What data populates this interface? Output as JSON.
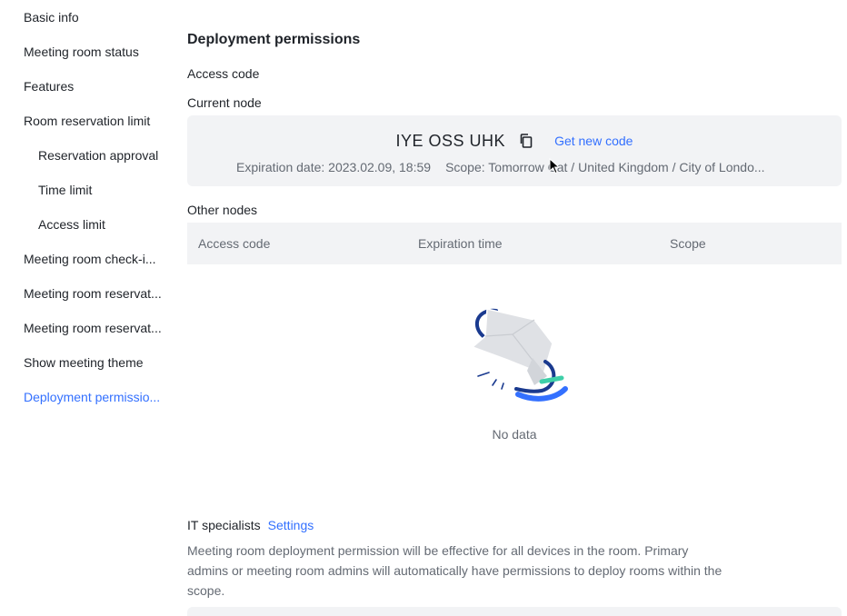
{
  "sidebar": {
    "items": [
      {
        "label": "Basic info"
      },
      {
        "label": "Meeting room status"
      },
      {
        "label": "Features"
      },
      {
        "label": "Room reservation limit"
      },
      {
        "label": "Reservation approval"
      },
      {
        "label": "Time limit"
      },
      {
        "label": "Access limit"
      },
      {
        "label": "Meeting room check-i..."
      },
      {
        "label": "Meeting room reservat..."
      },
      {
        "label": "Meeting room reservat..."
      },
      {
        "label": "Show meeting theme"
      },
      {
        "label": "Deployment permissio..."
      }
    ],
    "active_index": 11
  },
  "main": {
    "title": "Deployment permissions",
    "access_code_label": "Access code",
    "current_node_label": "Current node",
    "current_node": {
      "code": "IYE OSS UHK",
      "copy_icon": "copy-icon",
      "get_new_code": "Get new code",
      "expiration": "Expiration date: 2023.02.09, 18:59",
      "scope": "Scope:  Tomorrow Cat / United Kingdom / City of Londo..."
    },
    "other_nodes_label": "Other nodes",
    "table": {
      "columns": [
        "Access code",
        "Expiration time",
        "Scope"
      ],
      "rows": [],
      "empty_text": "No data"
    },
    "it_specialists": {
      "title": "IT specialists",
      "settings": "Settings",
      "description": "Meeting room deployment permission will be effective for all devices in the room. Primary admins or meeting room admins will automatically have permissions to deploy rooms within the scope."
    }
  },
  "colors": {
    "accent": "#3370ff",
    "text": "#1f2329",
    "secondary_text": "#646a73",
    "panel_bg": "#f2f3f5"
  }
}
